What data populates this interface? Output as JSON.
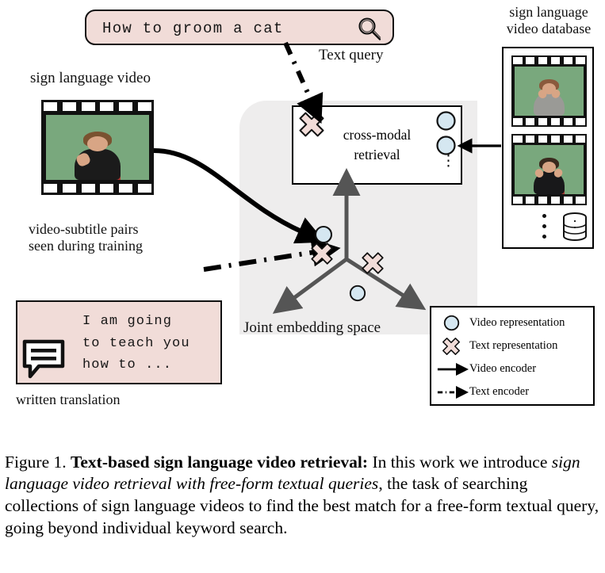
{
  "figure": {
    "search": {
      "query_text": "How to groom a cat",
      "icon": "magnifier-icon",
      "label": "Text query"
    },
    "video_sample": {
      "label": "sign language video",
      "caption_below": "video-subtitle pairs\nseen during training",
      "caption_line1": "video-subtitle pairs",
      "caption_line2": "seen during training"
    },
    "translation": {
      "line1": "I am going",
      "line2": "to teach you",
      "line3": "how to ...",
      "icon": "speech-bubble-icon",
      "label": "written translation"
    },
    "database": {
      "title_line1": "sign language",
      "title_line2": "video database",
      "icon": "database-cylinder-icon",
      "ellipsis": "⋮"
    },
    "retrieval": {
      "line1": "cross-modal",
      "line2": "retrieval",
      "ellipsis": "⋮"
    },
    "embedding": {
      "label": "Joint  embedding space"
    },
    "legend": {
      "items": [
        {
          "glyph": "circle-glyph",
          "label": "Video representation"
        },
        {
          "glyph": "cross-glyph",
          "label": "Text representation"
        },
        {
          "glyph": "solid-arrow-glyph",
          "label": "Video encoder"
        },
        {
          "glyph": "dashdot-arrow-glyph",
          "label": "Text encoder"
        }
      ]
    },
    "colors": {
      "pink_fill": "#f1dcd8",
      "blue_fill": "#d5e7f1",
      "panel_gray": "#eeeded",
      "screen_green": "#79a87d",
      "axis_gray": "#555555",
      "outline": "#111111"
    }
  },
  "caption": {
    "prefix": "Figure 1. ",
    "bold": "Text-based sign language video retrieval:",
    "text1": " In this work we introduce ",
    "italic": "sign language video retrieval with free-form textual queries",
    "text2": ", the task of searching collections of sign language videos to find the best match for a free-form textual query, going beyond individual keyword search."
  }
}
